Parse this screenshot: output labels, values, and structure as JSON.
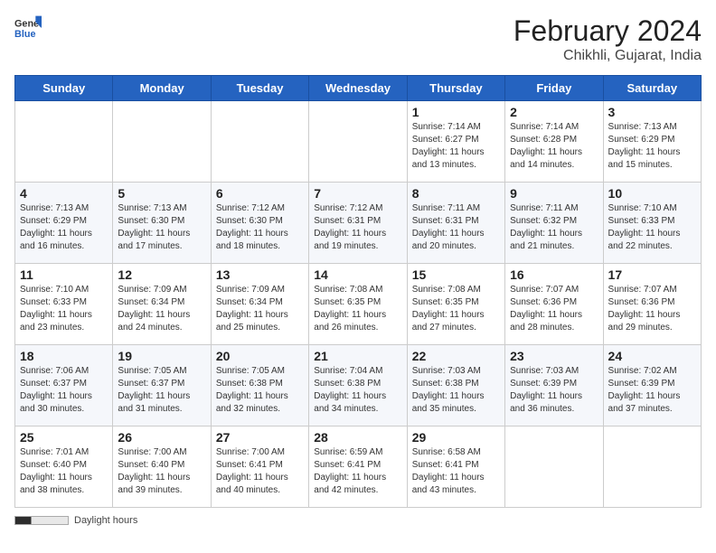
{
  "header": {
    "logo_general": "General",
    "logo_blue": "Blue",
    "month_year": "February 2024",
    "location": "Chikhli, Gujarat, India"
  },
  "days_of_week": [
    "Sunday",
    "Monday",
    "Tuesday",
    "Wednesday",
    "Thursday",
    "Friday",
    "Saturday"
  ],
  "weeks": [
    [
      {
        "day": "",
        "info": ""
      },
      {
        "day": "",
        "info": ""
      },
      {
        "day": "",
        "info": ""
      },
      {
        "day": "",
        "info": ""
      },
      {
        "day": "1",
        "info": "Sunrise: 7:14 AM\nSunset: 6:27 PM\nDaylight: 11 hours\nand 13 minutes."
      },
      {
        "day": "2",
        "info": "Sunrise: 7:14 AM\nSunset: 6:28 PM\nDaylight: 11 hours\nand 14 minutes."
      },
      {
        "day": "3",
        "info": "Sunrise: 7:13 AM\nSunset: 6:29 PM\nDaylight: 11 hours\nand 15 minutes."
      }
    ],
    [
      {
        "day": "4",
        "info": "Sunrise: 7:13 AM\nSunset: 6:29 PM\nDaylight: 11 hours\nand 16 minutes."
      },
      {
        "day": "5",
        "info": "Sunrise: 7:13 AM\nSunset: 6:30 PM\nDaylight: 11 hours\nand 17 minutes."
      },
      {
        "day": "6",
        "info": "Sunrise: 7:12 AM\nSunset: 6:30 PM\nDaylight: 11 hours\nand 18 minutes."
      },
      {
        "day": "7",
        "info": "Sunrise: 7:12 AM\nSunset: 6:31 PM\nDaylight: 11 hours\nand 19 minutes."
      },
      {
        "day": "8",
        "info": "Sunrise: 7:11 AM\nSunset: 6:31 PM\nDaylight: 11 hours\nand 20 minutes."
      },
      {
        "day": "9",
        "info": "Sunrise: 7:11 AM\nSunset: 6:32 PM\nDaylight: 11 hours\nand 21 minutes."
      },
      {
        "day": "10",
        "info": "Sunrise: 7:10 AM\nSunset: 6:33 PM\nDaylight: 11 hours\nand 22 minutes."
      }
    ],
    [
      {
        "day": "11",
        "info": "Sunrise: 7:10 AM\nSunset: 6:33 PM\nDaylight: 11 hours\nand 23 minutes."
      },
      {
        "day": "12",
        "info": "Sunrise: 7:09 AM\nSunset: 6:34 PM\nDaylight: 11 hours\nand 24 minutes."
      },
      {
        "day": "13",
        "info": "Sunrise: 7:09 AM\nSunset: 6:34 PM\nDaylight: 11 hours\nand 25 minutes."
      },
      {
        "day": "14",
        "info": "Sunrise: 7:08 AM\nSunset: 6:35 PM\nDaylight: 11 hours\nand 26 minutes."
      },
      {
        "day": "15",
        "info": "Sunrise: 7:08 AM\nSunset: 6:35 PM\nDaylight: 11 hours\nand 27 minutes."
      },
      {
        "day": "16",
        "info": "Sunrise: 7:07 AM\nSunset: 6:36 PM\nDaylight: 11 hours\nand 28 minutes."
      },
      {
        "day": "17",
        "info": "Sunrise: 7:07 AM\nSunset: 6:36 PM\nDaylight: 11 hours\nand 29 minutes."
      }
    ],
    [
      {
        "day": "18",
        "info": "Sunrise: 7:06 AM\nSunset: 6:37 PM\nDaylight: 11 hours\nand 30 minutes."
      },
      {
        "day": "19",
        "info": "Sunrise: 7:05 AM\nSunset: 6:37 PM\nDaylight: 11 hours\nand 31 minutes."
      },
      {
        "day": "20",
        "info": "Sunrise: 7:05 AM\nSunset: 6:38 PM\nDaylight: 11 hours\nand 32 minutes."
      },
      {
        "day": "21",
        "info": "Sunrise: 7:04 AM\nSunset: 6:38 PM\nDaylight: 11 hours\nand 34 minutes."
      },
      {
        "day": "22",
        "info": "Sunrise: 7:03 AM\nSunset: 6:38 PM\nDaylight: 11 hours\nand 35 minutes."
      },
      {
        "day": "23",
        "info": "Sunrise: 7:03 AM\nSunset: 6:39 PM\nDaylight: 11 hours\nand 36 minutes."
      },
      {
        "day": "24",
        "info": "Sunrise: 7:02 AM\nSunset: 6:39 PM\nDaylight: 11 hours\nand 37 minutes."
      }
    ],
    [
      {
        "day": "25",
        "info": "Sunrise: 7:01 AM\nSunset: 6:40 PM\nDaylight: 11 hours\nand 38 minutes."
      },
      {
        "day": "26",
        "info": "Sunrise: 7:00 AM\nSunset: 6:40 PM\nDaylight: 11 hours\nand 39 minutes."
      },
      {
        "day": "27",
        "info": "Sunrise: 7:00 AM\nSunset: 6:41 PM\nDaylight: 11 hours\nand 40 minutes."
      },
      {
        "day": "28",
        "info": "Sunrise: 6:59 AM\nSunset: 6:41 PM\nDaylight: 11 hours\nand 42 minutes."
      },
      {
        "day": "29",
        "info": "Sunrise: 6:58 AM\nSunset: 6:41 PM\nDaylight: 11 hours\nand 43 minutes."
      },
      {
        "day": "",
        "info": ""
      },
      {
        "day": "",
        "info": ""
      }
    ]
  ],
  "footer": {
    "daylight_label": "Daylight hours"
  }
}
